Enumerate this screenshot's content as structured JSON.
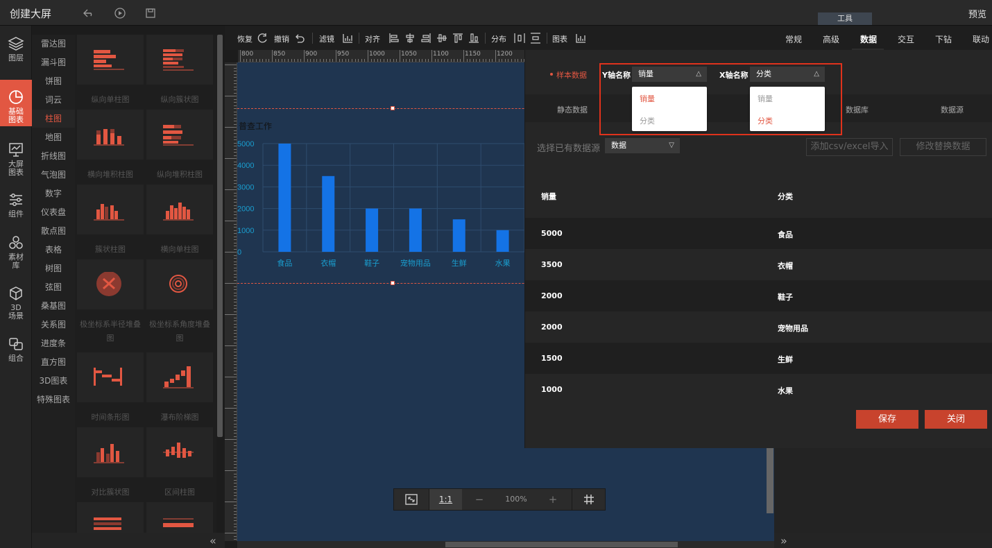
{
  "app": {
    "title": "创建大屏",
    "preview_label": "预览",
    "tools_label": "工具"
  },
  "rail": [
    {
      "label_1": "图层",
      "label_2": "",
      "icon": "layers-icon"
    },
    {
      "label_1": "基础",
      "label_2": "图表",
      "icon": "pie-chart-icon"
    },
    {
      "label_1": "大屏",
      "label_2": "图表",
      "icon": "presentation-chart-icon"
    },
    {
      "label_1": "组件",
      "label_2": "",
      "icon": "sliders-icon"
    },
    {
      "label_1": "素材",
      "label_2": "库",
      "icon": "assets-icon"
    },
    {
      "label_1": "3D",
      "label_2": "场景",
      "icon": "cube-icon"
    },
    {
      "label_1": "组合",
      "label_2": "",
      "icon": "group-icon"
    }
  ],
  "categories": [
    "雷达图",
    "漏斗图",
    "饼图",
    "词云",
    "柱图",
    "地图",
    "折线图",
    "气泡图",
    "数字",
    "仪表盘",
    "散点图",
    "表格",
    "树图",
    "弦图",
    "桑基图",
    "关系图",
    "进度条",
    "直方图",
    "3D图表",
    "特殊图表"
  ],
  "thumbs": [
    {
      "label": "纵向单柱图",
      "label2": ""
    },
    {
      "label": "纵向簇状图",
      "label2": ""
    },
    {
      "label": "横向堆积柱图",
      "label2": ""
    },
    {
      "label": "纵向堆积柱图",
      "label2": ""
    },
    {
      "label": "簇状柱图",
      "label2": ""
    },
    {
      "label": "横向单柱图",
      "label2": ""
    },
    {
      "label": "极坐标系半径堆叠",
      "label2": "图"
    },
    {
      "label": "极坐标系角度堆叠",
      "label2": "图"
    },
    {
      "label": "时间条形图",
      "label2": ""
    },
    {
      "label": "瀑布阶梯图",
      "label2": ""
    },
    {
      "label": "对比簇状图",
      "label2": ""
    },
    {
      "label": "区间柱图",
      "label2": ""
    }
  ],
  "toolbar": {
    "redo": "恢复",
    "undo": "撤销",
    "filter": "滤镜",
    "align": "对齐",
    "distribute": "分布",
    "chart": "图表"
  },
  "ruler": {
    "h_labels": [
      "800",
      "850",
      "900",
      "950",
      "1000",
      "1050",
      "1100",
      "1150",
      "1200"
    ]
  },
  "canvas_chart": {
    "title": "普查工作",
    "zoom": {
      "fit_label": "1:1",
      "minus": "−",
      "value": "100%",
      "plus": "+"
    }
  },
  "chart_data": {
    "type": "bar",
    "title": "普查工作",
    "categories": [
      "食品",
      "衣帽",
      "鞋子",
      "宠物用品",
      "生鲜",
      "水果"
    ],
    "series": [
      {
        "values": [
          5000,
          3500,
          2000,
          2000,
          1500,
          1000
        ]
      }
    ],
    "ylim": [
      0,
      5000
    ],
    "yticks": [
      "0",
      "1000",
      "2000",
      "3000",
      "4000",
      "5000"
    ],
    "grid": true,
    "bar_color": "#1473e6",
    "axis_color": "#1a9ecf"
  },
  "right_tabs": [
    "常规",
    "高级",
    "数据",
    "交互",
    "下钻",
    "联动"
  ],
  "data_panel": {
    "sample_label": "样本数据",
    "y_label": "Y轴名称",
    "y_value": "销量",
    "x_label": "X轴名称",
    "x_value": "分类",
    "y_options": [
      "销量",
      "分类"
    ],
    "x_options": [
      "销量",
      "分类"
    ],
    "tabs": [
      "静态数据",
      "数据库",
      "数据源"
    ],
    "source_label": "选择已有数据源",
    "source_value": "数据",
    "import_btn": "添加csv/excel导入",
    "modify_btn": "修改替换数据",
    "headers": [
      "销量",
      "分类"
    ],
    "rows": [
      [
        "5000",
        "食品"
      ],
      [
        "3500",
        "衣帽"
      ],
      [
        "2000",
        "鞋子"
      ],
      [
        "2000",
        "宠物用品"
      ],
      [
        "1500",
        "生鲜"
      ],
      [
        "1000",
        "水果"
      ]
    ],
    "save_label": "保存",
    "close_label": "关闭"
  },
  "colors": {
    "accent": "#e25742",
    "canvas_bg": "#1f3550",
    "highlight_border": "#e0321c"
  }
}
